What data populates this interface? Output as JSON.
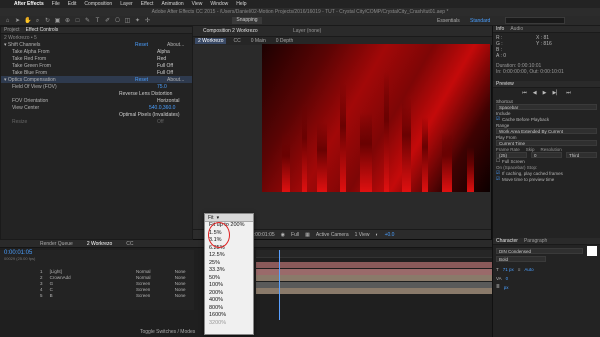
{
  "menubar": {
    "apple": "",
    "app_name": "After Effects",
    "items": [
      "File",
      "Edit",
      "Composition",
      "Layer",
      "Effect",
      "Animation",
      "View",
      "Window",
      "Help"
    ]
  },
  "window_title": "Adobe After Effects CC 2015 - /Users/Daniel/02-Motion Projects/2016/16019 - TUT - Crystal City/COMP/CrystalCity_Crash/tut01.aep *",
  "workspace": {
    "label": "Snapping",
    "essentials": "Essentials",
    "standard": "Standard"
  },
  "project_panel": {
    "tabs": [
      "Project",
      "Effect Controls"
    ],
    "header": "2 Workrezo • 5",
    "effects": [
      {
        "name": "Shift Channels",
        "reset": "Reset",
        "about": "About..."
      },
      {
        "name": "Take Alpha From",
        "val": "Alpha"
      },
      {
        "name": "Take Red From",
        "val": "Red"
      },
      {
        "name": "Take Green From",
        "val": "Full Off"
      },
      {
        "name": "Take Blue From",
        "val": "Full Off"
      },
      {
        "name": "Optics Compensation",
        "reset": "Reset",
        "about": "About..."
      },
      {
        "name": "Field Of View (FOV)",
        "val": "75.0"
      },
      {
        "name": "",
        "val": "Reverse Lens Distortion"
      },
      {
        "name": "FOV Orientation",
        "val": "Horizontal"
      },
      {
        "name": "View Center",
        "val": "540.0,360.0"
      },
      {
        "name": "",
        "val": "Optimal Pixels (Invalidates)"
      },
      {
        "name": "Resize",
        "val": "Off"
      }
    ]
  },
  "composition": {
    "tab": "Composition 2 Workrezo",
    "layer_tab": "Layer (none)",
    "sub_tabs": [
      "2 Workrezo",
      "CC",
      "0 Main",
      "0 Depth"
    ]
  },
  "viewer_controls": {
    "timecode": "0:00:01:05",
    "res": "Full",
    "camera": "Active Camera",
    "view": "1 View",
    "exposure": "+0.0"
  },
  "zoom_dropdown": {
    "selected": "Fit",
    "options": [
      "Fit up to 200%",
      "1.5%",
      "3.1%",
      "6.25%",
      "12.5%",
      "25%",
      "33.3%",
      "50%",
      "100%",
      "200%",
      "400%",
      "800%",
      "1600%",
      "3200%"
    ]
  },
  "timeline": {
    "tabs": [
      "Render Queue",
      "2 Workrezo",
      "CC"
    ],
    "timecode": "0:00:01:05",
    "frames": "00029 (25.00 fps)",
    "layers": [
      {
        "num": "1",
        "name": "[Light]",
        "mode": "Normal",
        "parent": "None"
      },
      {
        "num": "2",
        "name": "CrownAdd",
        "mode": "Normal",
        "parent": "None"
      },
      {
        "num": "3",
        "name": "G",
        "mode": "Screen",
        "parent": "None"
      },
      {
        "num": "4",
        "name": "C",
        "mode": "Screen",
        "parent": "None"
      },
      {
        "num": "5",
        "name": "B",
        "mode": "Screen",
        "parent": "None"
      }
    ],
    "toggle_label": "Toggle Switches / Modes"
  },
  "info_panel": {
    "tabs": [
      "Info",
      "Audio"
    ],
    "r": "R :",
    "g": "G :",
    "b": "B :",
    "a": "A : 0",
    "x": "X : 81",
    "y": "Y : 816",
    "duration": "Duration: 0:00:10:01",
    "in": "In: 0:00:00:00, Out: 0:00:10:01",
    "preview": "Preview",
    "shortcut": "Shortcut",
    "shortcut_val": "Spacebar",
    "include": "Include",
    "cache": "Cache Before Playback",
    "range": "Range",
    "range_val": "Work Area Extended By Current",
    "play_from": "Play From",
    "play_from_val": "Current Time",
    "frame_rate": "Frame Rate",
    "skip": "Skip",
    "resolution": "Resolution",
    "fr_val": "(25)",
    "skip_val": "0",
    "res_val": "Third",
    "full_screen": "Full Screen",
    "on_stop": "On (Spacebar) Stop:",
    "if_caching": "If caching, play cached frames",
    "move_time": "Move time to preview time"
  },
  "character_panel": {
    "tabs": [
      "Character",
      "Paragraph"
    ],
    "font": "DIN Condensed",
    "style": "Bold",
    "size": "71 px",
    "leading": "Auto",
    "tracking": "0",
    "units": "px"
  }
}
